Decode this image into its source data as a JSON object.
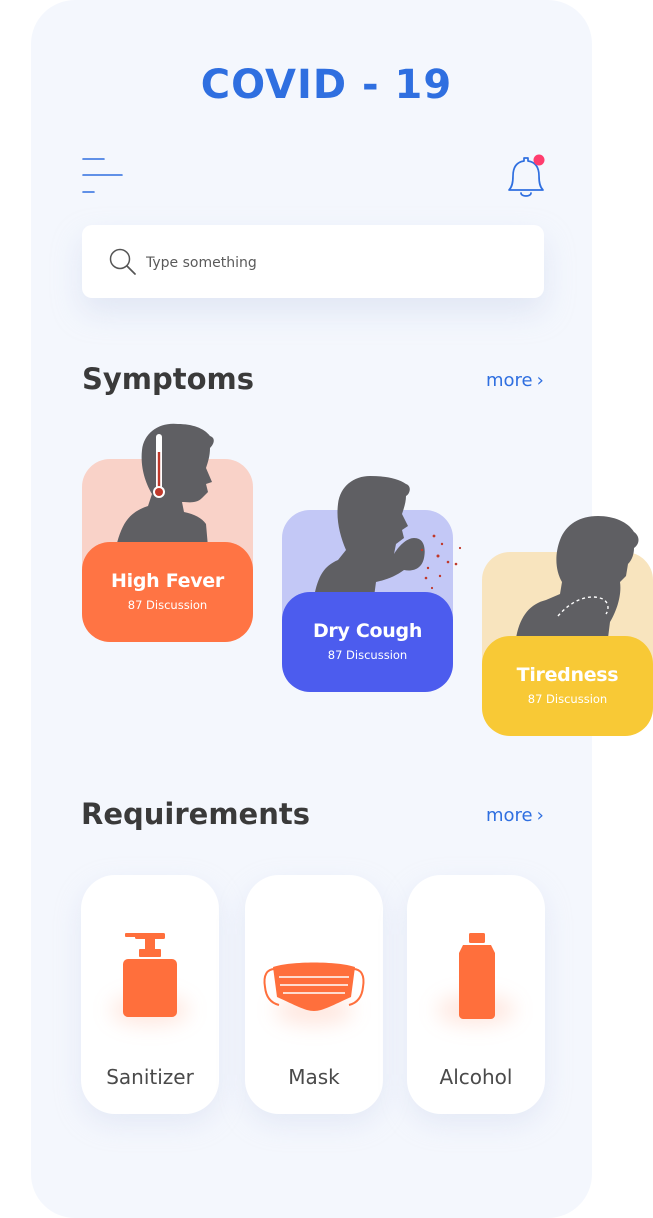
{
  "app": {
    "title": "COVID - 19"
  },
  "search": {
    "placeholder": "Type something"
  },
  "symptoms": {
    "title": "Symptoms",
    "more_label": "more",
    "items": [
      {
        "name": "High Fever",
        "discussion": "87 Discussion",
        "color": "#ff7444",
        "bg": "#f9d2c8"
      },
      {
        "name": "Dry Cough",
        "discussion": "87 Discussion",
        "color": "#4c5cee",
        "bg": "#c3c8f6"
      },
      {
        "name": "Tiredness",
        "discussion": "87 Discussion",
        "color": "#f8c936",
        "bg": "#f8e4be"
      }
    ]
  },
  "requirements": {
    "title": "Requirements",
    "more_label": "more",
    "items": [
      {
        "label": "Sanitizer",
        "icon": "sanitizer-bottle-icon"
      },
      {
        "label": "Mask",
        "icon": "face-mask-icon"
      },
      {
        "label": "Alcohol",
        "icon": "alcohol-bottle-icon"
      }
    ]
  },
  "colors": {
    "accent": "#2f6fe0",
    "notification_dot": "#ff3d6e",
    "silhouette": "#5f5f63",
    "item_icon": "#ff6f3c"
  }
}
